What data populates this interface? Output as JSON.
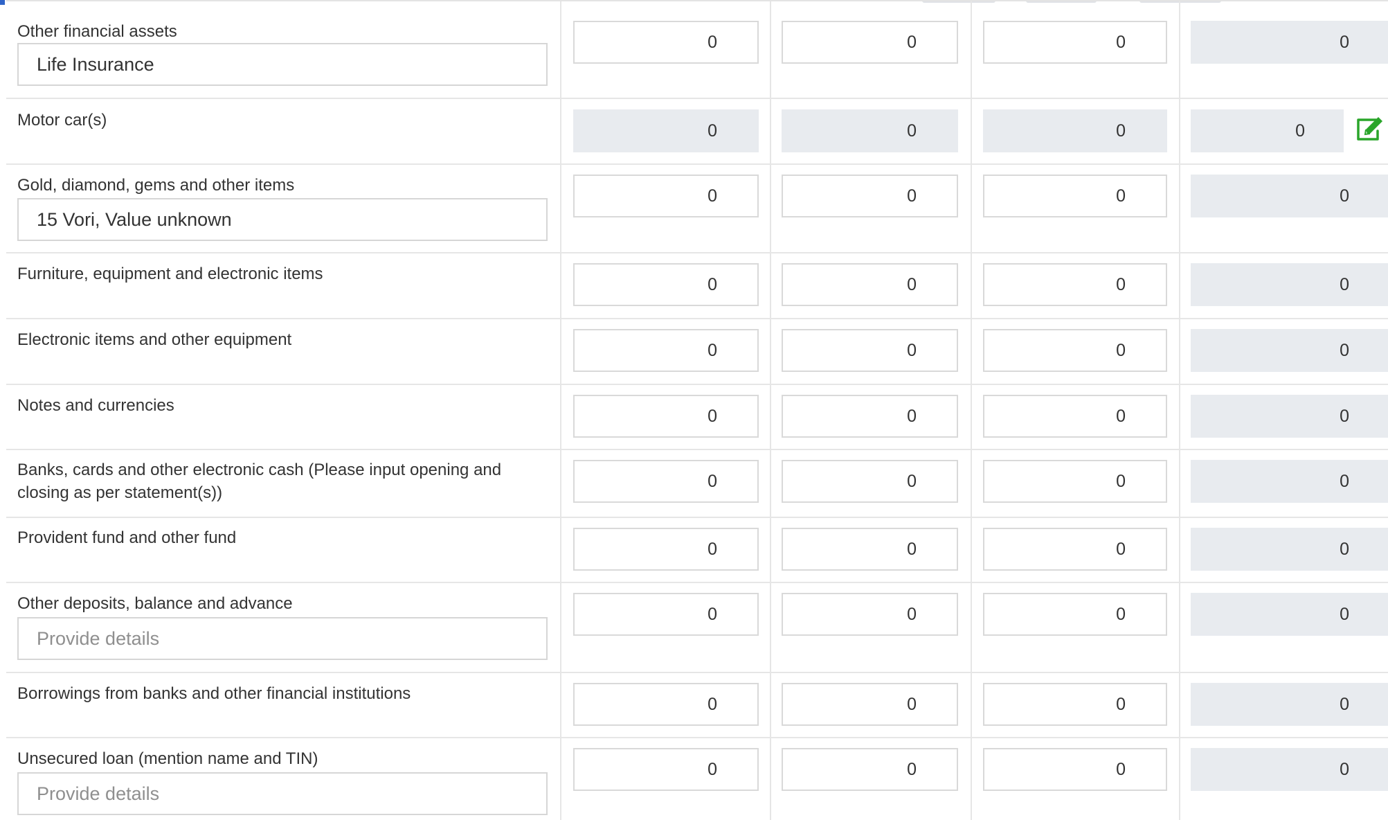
{
  "rows": [
    {
      "label": "Other financial assets",
      "details": "Life Insurance",
      "values": [
        "0",
        "0",
        "0",
        "0"
      ]
    },
    {
      "label": "Motor car(s)",
      "values": [
        "0",
        "0",
        "0",
        "0"
      ]
    },
    {
      "label": "Gold, diamond, gems and other items",
      "details": "15 Vori, Value unknown",
      "values": [
        "0",
        "0",
        "0",
        "0"
      ]
    },
    {
      "label": "Furniture, equipment and electronic items",
      "values": [
        "0",
        "0",
        "0",
        "0"
      ]
    },
    {
      "label": "Electronic items and other equipment",
      "values": [
        "0",
        "0",
        "0",
        "0"
      ]
    },
    {
      "label": "Notes and currencies",
      "values": [
        "0",
        "0",
        "0",
        "0"
      ]
    },
    {
      "label": "Banks, cards and other electronic cash (Please input opening and closing as per statement(s))",
      "values": [
        "0",
        "0",
        "0",
        "0"
      ]
    },
    {
      "label": "Provident fund and other fund",
      "values": [
        "0",
        "0",
        "0",
        "0"
      ]
    },
    {
      "label": "Other deposits, balance and advance",
      "details": "",
      "details_placeholder": "Provide details",
      "values": [
        "0",
        "0",
        "0",
        "0"
      ]
    },
    {
      "label": "Borrowings from banks and other financial institutions",
      "values": [
        "0",
        "0",
        "0",
        "0"
      ]
    },
    {
      "label": "Unsecured loan (mention name and TIN)",
      "details": "",
      "details_placeholder": "Provide details",
      "values": [
        "0",
        "0",
        "0",
        "0"
      ]
    }
  ],
  "icons": {
    "edit": "edit-icon"
  },
  "colors": {
    "edit_icon": "#2aa52a",
    "readonly_field": "#e8ebef"
  }
}
